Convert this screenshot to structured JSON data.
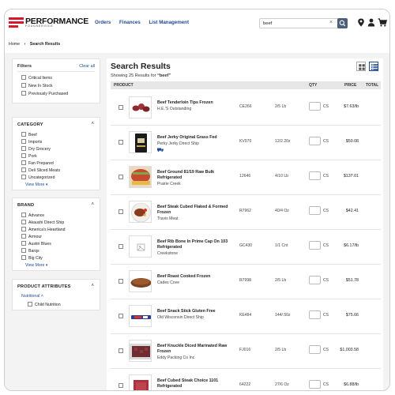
{
  "header": {
    "logo_text": "PERFORMANCE",
    "logo_sub": "FOODSERVICE",
    "nav": [
      "Orders",
      "Finances",
      "List Management"
    ],
    "search_value": "beef",
    "brand_red": "#d7192c"
  },
  "breadcrumb": {
    "home": "Home",
    "sep": "›",
    "current": "Search Results"
  },
  "filters": {
    "title": "Filters",
    "clear_all": "Clear all",
    "top_options": [
      "Critical Items",
      "New In Stock",
      "Previously Purchased"
    ],
    "category": {
      "title": "CATEGORY",
      "options": [
        "Beef",
        "Imports",
        "Dry Grocery",
        "Pork",
        "Fan Prepared",
        "Deli Sliced Meats",
        "Uncategorized"
      ],
      "view_more": "View More"
    },
    "brand": {
      "title": "BRAND",
      "options": [
        "Advance",
        "Akaushi Direct Ship",
        "America's Heartland",
        "Armour",
        "Austin Blues",
        "Barqs",
        "Big City"
      ],
      "view_more": "View More"
    },
    "attributes": {
      "title": "PRODUCT ATTRIBUTES",
      "sub": "Nutritional",
      "options": [
        "Child Nutrition"
      ]
    }
  },
  "results": {
    "title": "Search Results",
    "showing_prefix": "Showing 25 Results for ",
    "query": "“beef”",
    "columns": {
      "product": "PRODUCT",
      "qty": "QTY",
      "price": "PRICE",
      "total": "TOTAL"
    },
    "rows": [
      {
        "name": "Beef Tenderloin Tips Frozen",
        "brand": "H.E.'S Outstanding",
        "code": "CE266",
        "pack": "2/5 Lb",
        "unit": "CS",
        "price": "$7.63/lb",
        "thumb": "meat"
      },
      {
        "name": "Beef Jerky Original Grass Fed",
        "brand": "Perky Jerky Direct Ship",
        "code": "KV970",
        "pack": "12/2.20z",
        "unit": "CS",
        "price": "$50.08",
        "thumb": "jerky",
        "badge": true
      },
      {
        "name": "Beef Ground 81/19 Raw Bulk Refrigerated",
        "brand": "Prairie Creek",
        "code": "12646",
        "pack": "4/10 Lb",
        "unit": "CS",
        "price": "$137.01",
        "thumb": "ground"
      },
      {
        "name": "Beef Steak Cubed Flaked & Formed Frozen",
        "brand": "Travis Meat",
        "code": "R7962",
        "pack": "40/4 Oz",
        "unit": "CS",
        "price": "$42.41",
        "thumb": "steak"
      },
      {
        "name": "Beef Rib Bone In Prime Cap On 103 Refrigerated",
        "brand": "Creekstone",
        "code": "GC430",
        "pack": "1/1 Cnt",
        "unit": "CS",
        "price": "$6.17/lb",
        "thumb": "placeholder"
      },
      {
        "name": "Beef Roast Cooked Frozen",
        "brand": "Cades Cove",
        "code": "R7998",
        "pack": "2/5 Lb",
        "unit": "CS",
        "price": "$51.78",
        "thumb": "roast"
      },
      {
        "name": "Beef Snack Stick Gluten Free",
        "brand": "Old Wisconsin Direct Ship",
        "code": "KE484",
        "pack": "144/.50z",
        "unit": "CS",
        "price": "$75.66",
        "thumb": "stick"
      },
      {
        "name": "Beef Knuckle Diced Marinated Raw Frozen",
        "brand": "Eddy Packing Co Inc",
        "code": "FJ016",
        "pack": "2/5 Lb",
        "unit": "CS",
        "price": "$1,003.58",
        "thumb": "diced"
      },
      {
        "name": "Beef Cubed Steak Choice 1101 Refrigerated",
        "brand": "",
        "code": "64222",
        "pack": "27/6 Oz",
        "unit": "CS",
        "price": "$6.88/lb",
        "thumb": "cubed"
      }
    ]
  }
}
